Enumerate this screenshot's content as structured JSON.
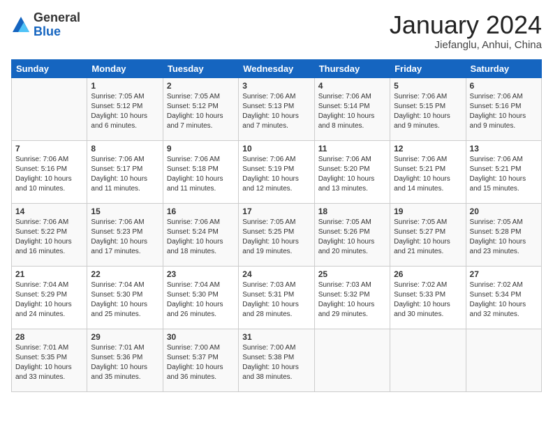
{
  "header": {
    "logo": {
      "general": "General",
      "blue": "Blue"
    },
    "title": "January 2024",
    "subtitle": "Jiefanglu, Anhui, China"
  },
  "days_of_week": [
    "Sunday",
    "Monday",
    "Tuesday",
    "Wednesday",
    "Thursday",
    "Friday",
    "Saturday"
  ],
  "weeks": [
    [
      {
        "day": null,
        "info": null
      },
      {
        "day": "1",
        "sunrise": "7:05 AM",
        "sunset": "5:12 PM",
        "daylight": "10 hours and 6 minutes."
      },
      {
        "day": "2",
        "sunrise": "7:05 AM",
        "sunset": "5:12 PM",
        "daylight": "10 hours and 7 minutes."
      },
      {
        "day": "3",
        "sunrise": "7:06 AM",
        "sunset": "5:13 PM",
        "daylight": "10 hours and 7 minutes."
      },
      {
        "day": "4",
        "sunrise": "7:06 AM",
        "sunset": "5:14 PM",
        "daylight": "10 hours and 8 minutes."
      },
      {
        "day": "5",
        "sunrise": "7:06 AM",
        "sunset": "5:15 PM",
        "daylight": "10 hours and 9 minutes."
      },
      {
        "day": "6",
        "sunrise": "7:06 AM",
        "sunset": "5:16 PM",
        "daylight": "10 hours and 9 minutes."
      }
    ],
    [
      {
        "day": "7",
        "sunrise": "7:06 AM",
        "sunset": "5:16 PM",
        "daylight": "10 hours and 10 minutes."
      },
      {
        "day": "8",
        "sunrise": "7:06 AM",
        "sunset": "5:17 PM",
        "daylight": "10 hours and 11 minutes."
      },
      {
        "day": "9",
        "sunrise": "7:06 AM",
        "sunset": "5:18 PM",
        "daylight": "10 hours and 11 minutes."
      },
      {
        "day": "10",
        "sunrise": "7:06 AM",
        "sunset": "5:19 PM",
        "daylight": "10 hours and 12 minutes."
      },
      {
        "day": "11",
        "sunrise": "7:06 AM",
        "sunset": "5:20 PM",
        "daylight": "10 hours and 13 minutes."
      },
      {
        "day": "12",
        "sunrise": "7:06 AM",
        "sunset": "5:21 PM",
        "daylight": "10 hours and 14 minutes."
      },
      {
        "day": "13",
        "sunrise": "7:06 AM",
        "sunset": "5:21 PM",
        "daylight": "10 hours and 15 minutes."
      }
    ],
    [
      {
        "day": "14",
        "sunrise": "7:06 AM",
        "sunset": "5:22 PM",
        "daylight": "10 hours and 16 minutes."
      },
      {
        "day": "15",
        "sunrise": "7:06 AM",
        "sunset": "5:23 PM",
        "daylight": "10 hours and 17 minutes."
      },
      {
        "day": "16",
        "sunrise": "7:06 AM",
        "sunset": "5:24 PM",
        "daylight": "10 hours and 18 minutes."
      },
      {
        "day": "17",
        "sunrise": "7:05 AM",
        "sunset": "5:25 PM",
        "daylight": "10 hours and 19 minutes."
      },
      {
        "day": "18",
        "sunrise": "7:05 AM",
        "sunset": "5:26 PM",
        "daylight": "10 hours and 20 minutes."
      },
      {
        "day": "19",
        "sunrise": "7:05 AM",
        "sunset": "5:27 PM",
        "daylight": "10 hours and 21 minutes."
      },
      {
        "day": "20",
        "sunrise": "7:05 AM",
        "sunset": "5:28 PM",
        "daylight": "10 hours and 23 minutes."
      }
    ],
    [
      {
        "day": "21",
        "sunrise": "7:04 AM",
        "sunset": "5:29 PM",
        "daylight": "10 hours and 24 minutes."
      },
      {
        "day": "22",
        "sunrise": "7:04 AM",
        "sunset": "5:30 PM",
        "daylight": "10 hours and 25 minutes."
      },
      {
        "day": "23",
        "sunrise": "7:04 AM",
        "sunset": "5:30 PM",
        "daylight": "10 hours and 26 minutes."
      },
      {
        "day": "24",
        "sunrise": "7:03 AM",
        "sunset": "5:31 PM",
        "daylight": "10 hours and 28 minutes."
      },
      {
        "day": "25",
        "sunrise": "7:03 AM",
        "sunset": "5:32 PM",
        "daylight": "10 hours and 29 minutes."
      },
      {
        "day": "26",
        "sunrise": "7:02 AM",
        "sunset": "5:33 PM",
        "daylight": "10 hours and 30 minutes."
      },
      {
        "day": "27",
        "sunrise": "7:02 AM",
        "sunset": "5:34 PM",
        "daylight": "10 hours and 32 minutes."
      }
    ],
    [
      {
        "day": "28",
        "sunrise": "7:01 AM",
        "sunset": "5:35 PM",
        "daylight": "10 hours and 33 minutes."
      },
      {
        "day": "29",
        "sunrise": "7:01 AM",
        "sunset": "5:36 PM",
        "daylight": "10 hours and 35 minutes."
      },
      {
        "day": "30",
        "sunrise": "7:00 AM",
        "sunset": "5:37 PM",
        "daylight": "10 hours and 36 minutes."
      },
      {
        "day": "31",
        "sunrise": "7:00 AM",
        "sunset": "5:38 PM",
        "daylight": "10 hours and 38 minutes."
      },
      {
        "day": null,
        "info": null
      },
      {
        "day": null,
        "info": null
      },
      {
        "day": null,
        "info": null
      }
    ]
  ],
  "labels": {
    "sunrise": "Sunrise:",
    "sunset": "Sunset:",
    "daylight": "Daylight:"
  }
}
